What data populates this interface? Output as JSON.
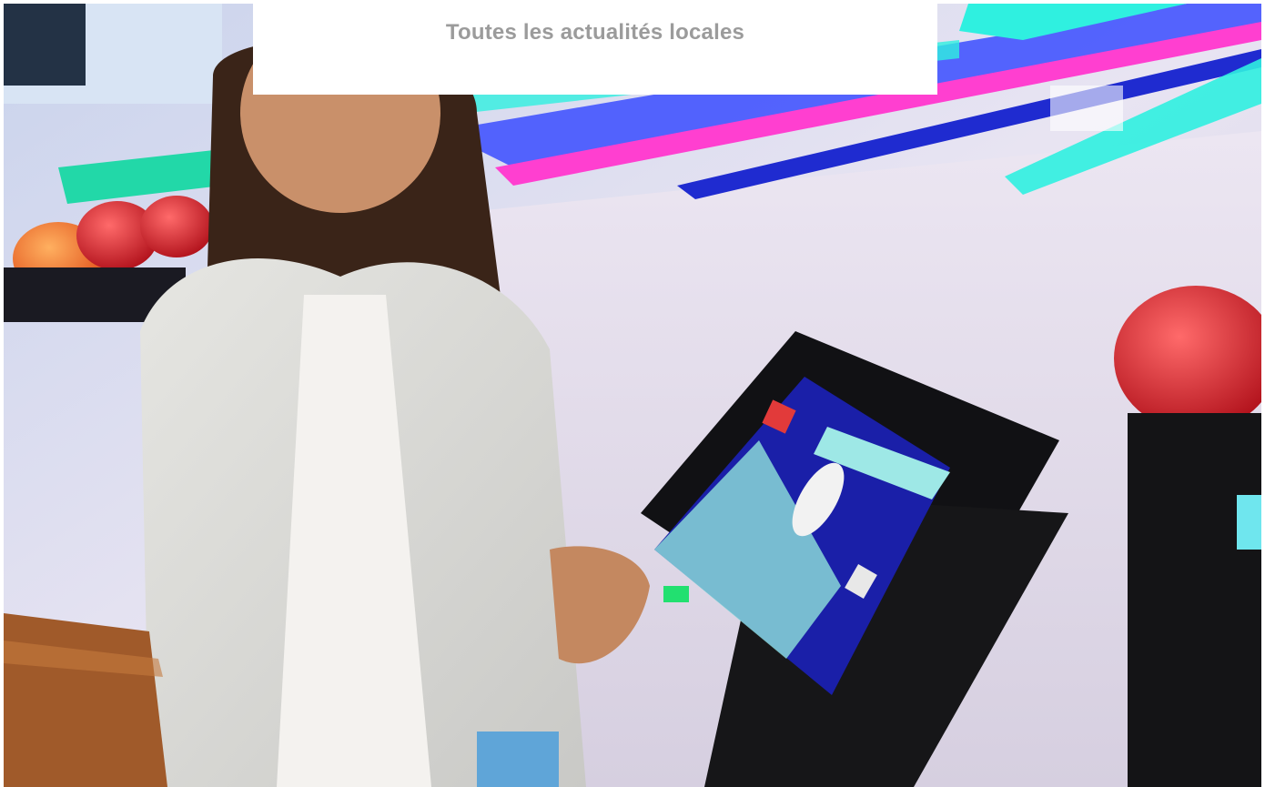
{
  "banner": {
    "link_label": "Toutes les actualités locales"
  },
  "photo": {
    "subject": "woman-at-bowling-kiosk"
  },
  "colors": {
    "banner_text": "#9b9b9b",
    "banner_bg": "#ffffff",
    "neon_cyan": "#2ff0e0",
    "neon_magenta": "#ff3fd0",
    "neon_blue": "#3a4cff",
    "kiosk_screen": "#1a1fa8"
  }
}
